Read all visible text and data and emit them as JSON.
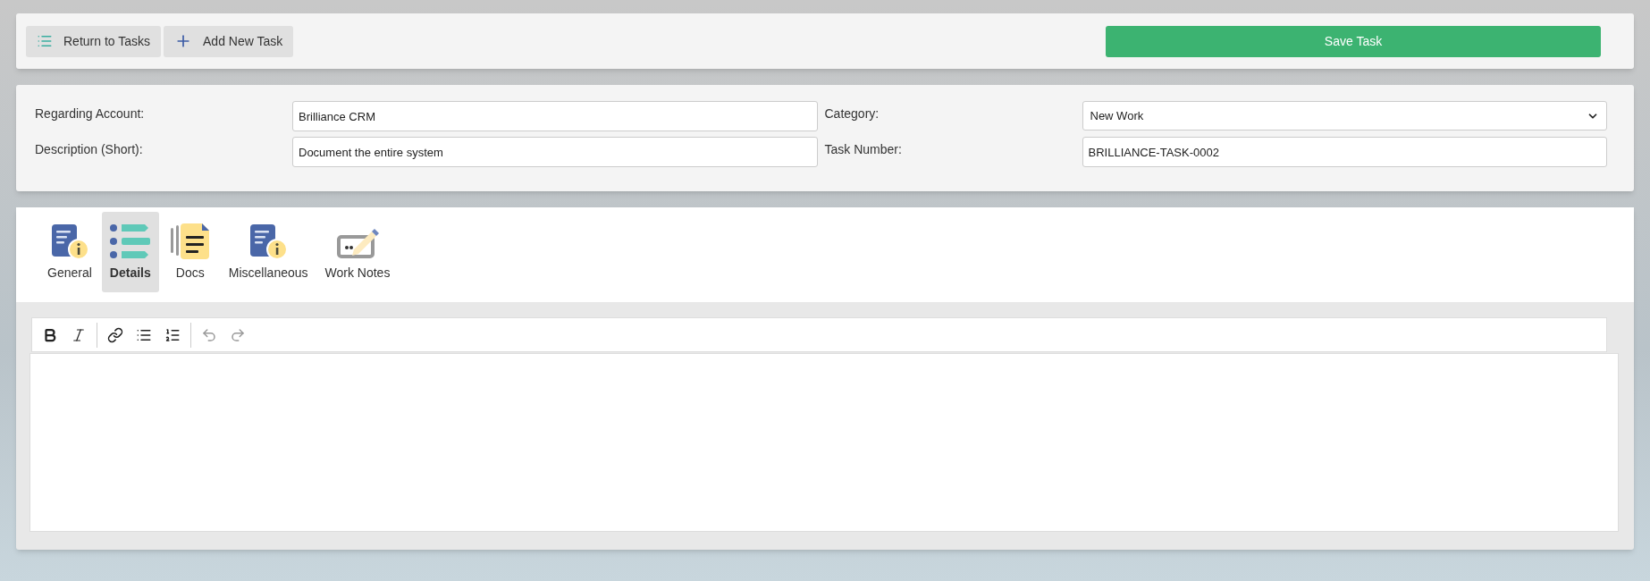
{
  "toolbar": {
    "buttons": [
      {
        "label": "Return to Tasks",
        "kind": "list"
      },
      {
        "label": "Add New Task",
        "kind": "add"
      }
    ],
    "save_button": "Save Task"
  },
  "form": {
    "fields": [
      {
        "label": "Regarding Account:",
        "value": "Brilliance CRM",
        "kind": "text"
      },
      {
        "label": "Category:",
        "value": "New Work",
        "kind": "select"
      },
      {
        "label": "Description (Short):",
        "value": "Document the entire system",
        "kind": "text"
      },
      {
        "label": "Task Number:",
        "value": "BRILLIANCE-TASK-0002",
        "kind": "text"
      }
    ]
  },
  "tabs": [
    {
      "label": "General",
      "kind": "info",
      "selected": false
    },
    {
      "label": "Details",
      "kind": "details",
      "selected": true
    },
    {
      "label": "Docs",
      "kind": "docs",
      "selected": false
    },
    {
      "label": "Miscellaneous",
      "kind": "info",
      "selected": false
    },
    {
      "label": "Work Notes",
      "kind": "notes",
      "selected": false
    }
  ],
  "editor": {
    "tools": [
      {
        "kind": "bold"
      },
      {
        "kind": "italic"
      },
      {
        "kind": "sep"
      },
      {
        "kind": "link"
      },
      {
        "kind": "bullets"
      },
      {
        "kind": "numbers"
      },
      {
        "kind": "sep"
      },
      {
        "kind": "undo",
        "disabled": true
      },
      {
        "kind": "redo",
        "disabled": true
      }
    ]
  }
}
